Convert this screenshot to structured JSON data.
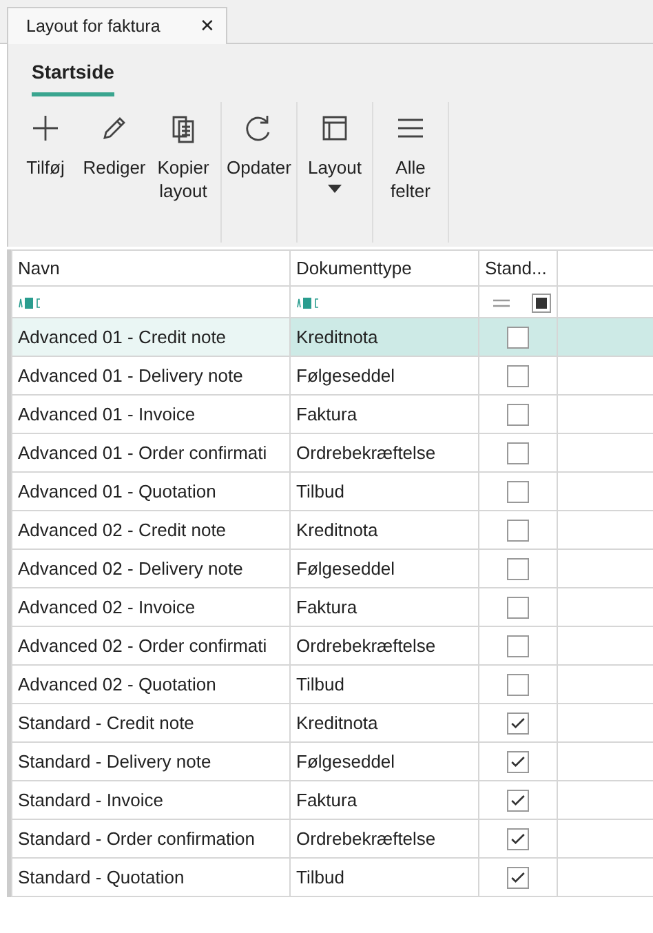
{
  "document_tab": {
    "title": "Layout for faktura",
    "close": "✕"
  },
  "ribbon": {
    "tabs": [
      {
        "label": "Startside",
        "selected": true
      }
    ],
    "groups": [
      [
        {
          "label": "Tilføj"
        },
        {
          "label": "Rediger"
        },
        {
          "label": "Kopier layout"
        }
      ],
      [
        {
          "label": "Opdater"
        }
      ],
      [
        {
          "label": "Layout",
          "dropdown": true
        }
      ],
      [
        {
          "label": "Alle felter"
        }
      ]
    ]
  },
  "table": {
    "columns": [
      "Navn",
      "Dokumenttype",
      "Stand..."
    ],
    "standard_filter": {
      "indeterminate": true
    },
    "rows": [
      {
        "navn": "Advanced 01 - Credit note",
        "type": "Kreditnota",
        "standard": false,
        "selected": true
      },
      {
        "navn": "Advanced 01 - Delivery note",
        "type": "Følgeseddel",
        "standard": false,
        "selected": false
      },
      {
        "navn": "Advanced 01 - Invoice",
        "type": "Faktura",
        "standard": false,
        "selected": false
      },
      {
        "navn": "Advanced 01 - Order confirmati",
        "type": "Ordrebekræftelse",
        "standard": false,
        "selected": false
      },
      {
        "navn": "Advanced 01 - Quotation",
        "type": "Tilbud",
        "standard": false,
        "selected": false
      },
      {
        "navn": "Advanced 02 - Credit note",
        "type": "Kreditnota",
        "standard": false,
        "selected": false
      },
      {
        "navn": "Advanced 02 - Delivery note",
        "type": "Følgeseddel",
        "standard": false,
        "selected": false
      },
      {
        "navn": "Advanced 02 - Invoice",
        "type": "Faktura",
        "standard": false,
        "selected": false
      },
      {
        "navn": "Advanced 02 - Order confirmati",
        "type": "Ordrebekræftelse",
        "standard": false,
        "selected": false
      },
      {
        "navn": "Advanced 02 - Quotation",
        "type": "Tilbud",
        "standard": false,
        "selected": false
      },
      {
        "navn": "Standard - Credit note",
        "type": "Kreditnota",
        "standard": true,
        "selected": false
      },
      {
        "navn": "Standard - Delivery note",
        "type": "Følgeseddel",
        "standard": true,
        "selected": false
      },
      {
        "navn": "Standard - Invoice",
        "type": "Faktura",
        "standard": true,
        "selected": false
      },
      {
        "navn": "Standard - Order confirmation",
        "type": "Ordrebekræftelse",
        "standard": true,
        "selected": false
      },
      {
        "navn": "Standard - Quotation",
        "type": "Tilbud",
        "standard": true,
        "selected": false
      }
    ]
  }
}
